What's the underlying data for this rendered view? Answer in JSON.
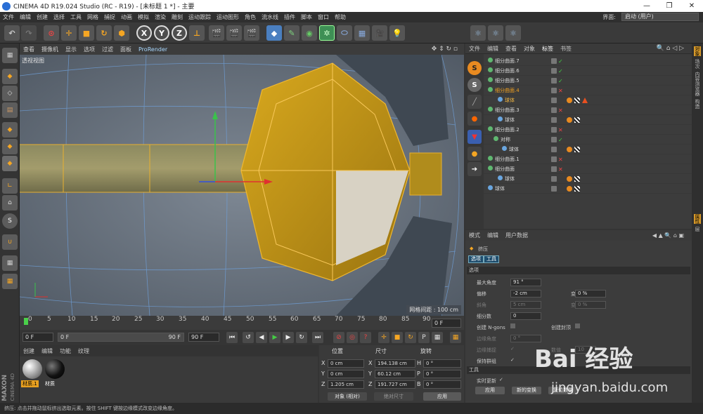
{
  "window": {
    "title": "CINEMA 4D R19.024 Studio (RC - R19) - [未标题 1 *] - 主要",
    "min": "—",
    "max": "❐",
    "close": "✕"
  },
  "menu": [
    "文件",
    "编辑",
    "创建",
    "选择",
    "工具",
    "网格",
    "捕捉",
    "动画",
    "模拟",
    "渲染",
    "雕刻",
    "运动跟踪",
    "运动图形",
    "角色",
    "流水线",
    "插件",
    "脚本",
    "窗口",
    "帮助"
  ],
  "interface": {
    "label": "界面:",
    "value": "启动 (用户)"
  },
  "toolbar": {
    "x": "X",
    "y": "Y",
    "z": "Z"
  },
  "viewport": {
    "menu": [
      "查看",
      "摄像机",
      "显示",
      "选项",
      "过滤",
      "面板",
      "ProRender"
    ],
    "label": "透视视图",
    "grid_spacing": "网格间距 : 100 cm"
  },
  "timeline": {
    "ticks": [
      "0",
      "5",
      "10",
      "15",
      "20",
      "25",
      "30",
      "35",
      "40",
      "45",
      "50",
      "55",
      "60",
      "65",
      "70",
      "75",
      "80",
      "85",
      "90"
    ],
    "current": "0 F"
  },
  "transport": {
    "start": "0 F",
    "min": "0 F",
    "max": "90 F",
    "end": "90 F"
  },
  "materials": {
    "menu": [
      "创建",
      "编辑",
      "功能",
      "纹理"
    ],
    "items": [
      {
        "label": "材质.1",
        "color": "#bbbbbb"
      },
      {
        "label": "材质",
        "color": "#111111"
      }
    ]
  },
  "coords": {
    "headers": {
      "pos": "位置",
      "size": "尺寸",
      "rot": "旋转"
    },
    "rows": [
      {
        "axis": "X",
        "pos": "0 cm",
        "saxis": "X",
        "size": "194.138 cm",
        "raxis": "H",
        "rot": "0 °"
      },
      {
        "axis": "Y",
        "pos": "0 cm",
        "saxis": "Y",
        "size": "60.12 cm",
        "raxis": "P",
        "rot": "0 °"
      },
      {
        "axis": "Z",
        "pos": "1.205 cm",
        "saxis": "Z",
        "size": "191.727 cm",
        "raxis": "B",
        "rot": "0 °"
      }
    ],
    "mode": "对象 (相对)",
    "size_mode": "绝对尺寸",
    "apply": "应用"
  },
  "brand": {
    "l1": "MAXON",
    "l2": "CINEMA 4D"
  },
  "status": "挤压: 点击并拖动鼠标挤出选取元素。按住 SHIFT 键按边缘模式改变边缘角度。",
  "objects": {
    "menu": [
      "文件",
      "编辑",
      "查看",
      "对象",
      "标签",
      "书签"
    ],
    "rows": [
      {
        "name": "细分曲面.7",
        "indent": 0,
        "v": "✓",
        "kind": "normal"
      },
      {
        "name": "细分曲面.6",
        "indent": 0,
        "v": "✓",
        "kind": "normal"
      },
      {
        "name": "细分曲面.5",
        "indent": 0,
        "v": "✓",
        "kind": "normal"
      },
      {
        "name": "细分曲面.4",
        "indent": 0,
        "v": "✕",
        "kind": "sel"
      },
      {
        "name": "球体",
        "indent": 1,
        "v": "",
        "kind": "child"
      },
      {
        "name": "细分曲面.3",
        "indent": 0,
        "v": "✕",
        "kind": "normal"
      },
      {
        "name": "球体",
        "indent": 1,
        "v": "",
        "kind": "normal"
      },
      {
        "name": "细分曲面.2",
        "indent": 0,
        "v": "✕",
        "kind": "normal"
      },
      {
        "name": "对称",
        "indent": 1,
        "v": "✓",
        "kind": "normal"
      },
      {
        "name": "球体",
        "indent": 2,
        "v": "",
        "kind": "normal"
      },
      {
        "name": "细分曲面.1",
        "indent": 0,
        "v": "✕",
        "kind": "normal"
      },
      {
        "name": "细分曲面",
        "indent": 0,
        "v": "✕",
        "kind": "normal"
      },
      {
        "name": "球体",
        "indent": 1,
        "v": "",
        "kind": "normal"
      },
      {
        "name": "球体",
        "indent": 0,
        "v": "",
        "kind": "normal"
      }
    ]
  },
  "side_tabs": [
    "对象",
    "场次",
    "内容浏览器",
    "构造",
    "属性",
    "层"
  ],
  "attributes": {
    "menu": [
      "模式",
      "编辑",
      "用户数据"
    ],
    "tool_name": "挤压",
    "tabs": [
      "选项",
      "工具"
    ],
    "section_options": "选项",
    "max_angle": {
      "label": "最大角度",
      "value": "91 °"
    },
    "offset": {
      "label": "偏移",
      "value": "-2 cm"
    },
    "variance": {
      "label": "变量",
      "value": "0 %"
    },
    "bevel": {
      "label": "斜角",
      "value": "5 cm"
    },
    "variance2": {
      "label": "变量",
      "value": "0 %"
    },
    "subdiv": {
      "label": "细分数",
      "value": "0"
    },
    "ngons": {
      "label": "创建 N-gons"
    },
    "caps": {
      "label": "创建封顶"
    },
    "edge_angle": {
      "label": "边缘角度",
      "value": "0 °"
    },
    "edge_snap": {
      "label": "边缘捕捉"
    },
    "value_label": "数值",
    "value_val": "10",
    "keep_groups": {
      "label": "保持群组"
    },
    "section_tool": "工具",
    "realtime": {
      "label": "实时更新"
    },
    "apply": "应用",
    "new_transform": "新的变换",
    "reset": "复位数值"
  },
  "watermark": {
    "brand": "Bai 经验",
    "url": "jingyan.baidu.com"
  }
}
